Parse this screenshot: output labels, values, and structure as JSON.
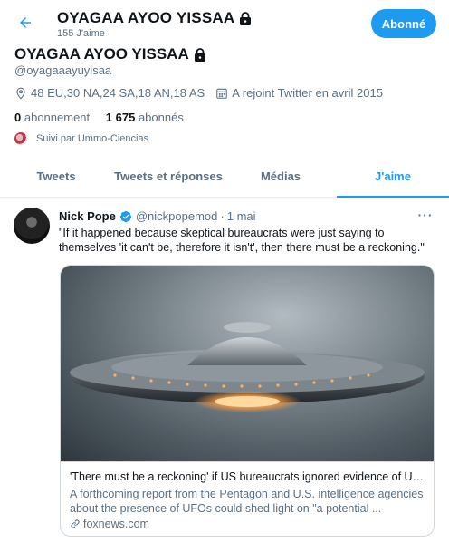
{
  "header": {
    "title": "OYAGAA AYOO YISSAA",
    "likes_count": "155 J'aime",
    "follow_button": "Abonné"
  },
  "profile": {
    "name": "OYAGAA AYOO YISSAA",
    "handle": "@oyagaaayuyisaa",
    "location": "48 EU,30 NA,24 SA,18 AN,18 AS",
    "joined": "A rejoint Twitter en avril 2015",
    "following_count": "0",
    "following_label": "abonnement",
    "followers_count": "1 675",
    "followers_label": "abonnés",
    "followed_by": "Suivi par Ummo-Ciencias"
  },
  "tabs": [
    {
      "label": "Tweets"
    },
    {
      "label": "Tweets et réponses"
    },
    {
      "label": "Médias"
    },
    {
      "label": "J'aime"
    }
  ],
  "active_tab": "J'aime",
  "tweet": {
    "author_name": "Nick Pope",
    "author_handle": "@nickpopemod",
    "dot": "·",
    "date": "1 mai",
    "text": "\"If it happened because skeptical bureaucrats were just saying to themselves 'it can't be, therefore it isn't', then there must be a reckoning.\"",
    "card": {
      "title": "'There must be a reckoning' if US bureaucrats ignored evidence of UF...",
      "description": "A forthcoming report from the Pentagon and U.S. intelligence agencies about the presence of UFOs could shed light on \"a potential ...",
      "domain": "foxnews.com"
    }
  },
  "colors": {
    "accent": "#1d9bf0",
    "secondary_text": "#5b7083",
    "primary_text": "#0f1419",
    "border": "#cfd9de"
  },
  "icons": [
    "back-arrow-icon",
    "lock-icon",
    "location-icon",
    "calendar-icon",
    "verified-icon",
    "more-icon",
    "link-icon"
  ]
}
